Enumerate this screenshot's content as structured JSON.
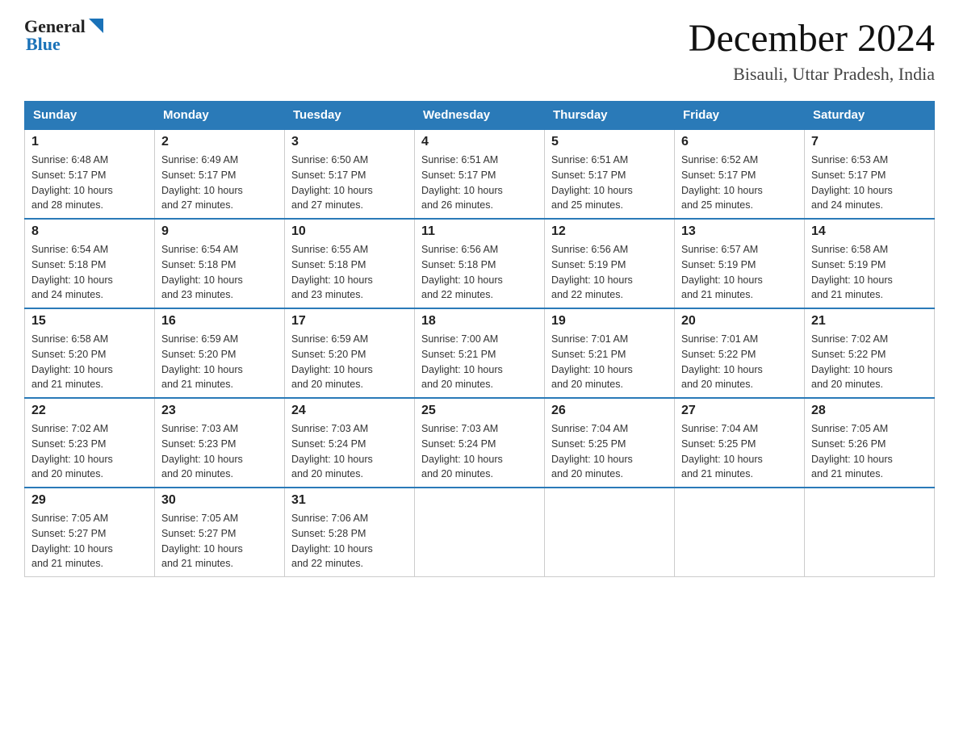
{
  "header": {
    "logo": {
      "general": "General",
      "blue": "Blue"
    },
    "title": "December 2024",
    "location": "Bisauli, Uttar Pradesh, India"
  },
  "calendar": {
    "days_of_week": [
      "Sunday",
      "Monday",
      "Tuesday",
      "Wednesday",
      "Thursday",
      "Friday",
      "Saturday"
    ],
    "weeks": [
      [
        {
          "day": "1",
          "sunrise": "6:48 AM",
          "sunset": "5:17 PM",
          "daylight": "10 hours and 28 minutes."
        },
        {
          "day": "2",
          "sunrise": "6:49 AM",
          "sunset": "5:17 PM",
          "daylight": "10 hours and 27 minutes."
        },
        {
          "day": "3",
          "sunrise": "6:50 AM",
          "sunset": "5:17 PM",
          "daylight": "10 hours and 27 minutes."
        },
        {
          "day": "4",
          "sunrise": "6:51 AM",
          "sunset": "5:17 PM",
          "daylight": "10 hours and 26 minutes."
        },
        {
          "day": "5",
          "sunrise": "6:51 AM",
          "sunset": "5:17 PM",
          "daylight": "10 hours and 25 minutes."
        },
        {
          "day": "6",
          "sunrise": "6:52 AM",
          "sunset": "5:17 PM",
          "daylight": "10 hours and 25 minutes."
        },
        {
          "day": "7",
          "sunrise": "6:53 AM",
          "sunset": "5:17 PM",
          "daylight": "10 hours and 24 minutes."
        }
      ],
      [
        {
          "day": "8",
          "sunrise": "6:54 AM",
          "sunset": "5:18 PM",
          "daylight": "10 hours and 24 minutes."
        },
        {
          "day": "9",
          "sunrise": "6:54 AM",
          "sunset": "5:18 PM",
          "daylight": "10 hours and 23 minutes."
        },
        {
          "day": "10",
          "sunrise": "6:55 AM",
          "sunset": "5:18 PM",
          "daylight": "10 hours and 23 minutes."
        },
        {
          "day": "11",
          "sunrise": "6:56 AM",
          "sunset": "5:18 PM",
          "daylight": "10 hours and 22 minutes."
        },
        {
          "day": "12",
          "sunrise": "6:56 AM",
          "sunset": "5:19 PM",
          "daylight": "10 hours and 22 minutes."
        },
        {
          "day": "13",
          "sunrise": "6:57 AM",
          "sunset": "5:19 PM",
          "daylight": "10 hours and 21 minutes."
        },
        {
          "day": "14",
          "sunrise": "6:58 AM",
          "sunset": "5:19 PM",
          "daylight": "10 hours and 21 minutes."
        }
      ],
      [
        {
          "day": "15",
          "sunrise": "6:58 AM",
          "sunset": "5:20 PM",
          "daylight": "10 hours and 21 minutes."
        },
        {
          "day": "16",
          "sunrise": "6:59 AM",
          "sunset": "5:20 PM",
          "daylight": "10 hours and 21 minutes."
        },
        {
          "day": "17",
          "sunrise": "6:59 AM",
          "sunset": "5:20 PM",
          "daylight": "10 hours and 20 minutes."
        },
        {
          "day": "18",
          "sunrise": "7:00 AM",
          "sunset": "5:21 PM",
          "daylight": "10 hours and 20 minutes."
        },
        {
          "day": "19",
          "sunrise": "7:01 AM",
          "sunset": "5:21 PM",
          "daylight": "10 hours and 20 minutes."
        },
        {
          "day": "20",
          "sunrise": "7:01 AM",
          "sunset": "5:22 PM",
          "daylight": "10 hours and 20 minutes."
        },
        {
          "day": "21",
          "sunrise": "7:02 AM",
          "sunset": "5:22 PM",
          "daylight": "10 hours and 20 minutes."
        }
      ],
      [
        {
          "day": "22",
          "sunrise": "7:02 AM",
          "sunset": "5:23 PM",
          "daylight": "10 hours and 20 minutes."
        },
        {
          "day": "23",
          "sunrise": "7:03 AM",
          "sunset": "5:23 PM",
          "daylight": "10 hours and 20 minutes."
        },
        {
          "day": "24",
          "sunrise": "7:03 AM",
          "sunset": "5:24 PM",
          "daylight": "10 hours and 20 minutes."
        },
        {
          "day": "25",
          "sunrise": "7:03 AM",
          "sunset": "5:24 PM",
          "daylight": "10 hours and 20 minutes."
        },
        {
          "day": "26",
          "sunrise": "7:04 AM",
          "sunset": "5:25 PM",
          "daylight": "10 hours and 20 minutes."
        },
        {
          "day": "27",
          "sunrise": "7:04 AM",
          "sunset": "5:25 PM",
          "daylight": "10 hours and 21 minutes."
        },
        {
          "day": "28",
          "sunrise": "7:05 AM",
          "sunset": "5:26 PM",
          "daylight": "10 hours and 21 minutes."
        }
      ],
      [
        {
          "day": "29",
          "sunrise": "7:05 AM",
          "sunset": "5:27 PM",
          "daylight": "10 hours and 21 minutes."
        },
        {
          "day": "30",
          "sunrise": "7:05 AM",
          "sunset": "5:27 PM",
          "daylight": "10 hours and 21 minutes."
        },
        {
          "day": "31",
          "sunrise": "7:06 AM",
          "sunset": "5:28 PM",
          "daylight": "10 hours and 22 minutes."
        },
        null,
        null,
        null,
        null
      ]
    ],
    "labels": {
      "sunrise": "Sunrise:",
      "sunset": "Sunset:",
      "daylight": "Daylight:"
    }
  }
}
